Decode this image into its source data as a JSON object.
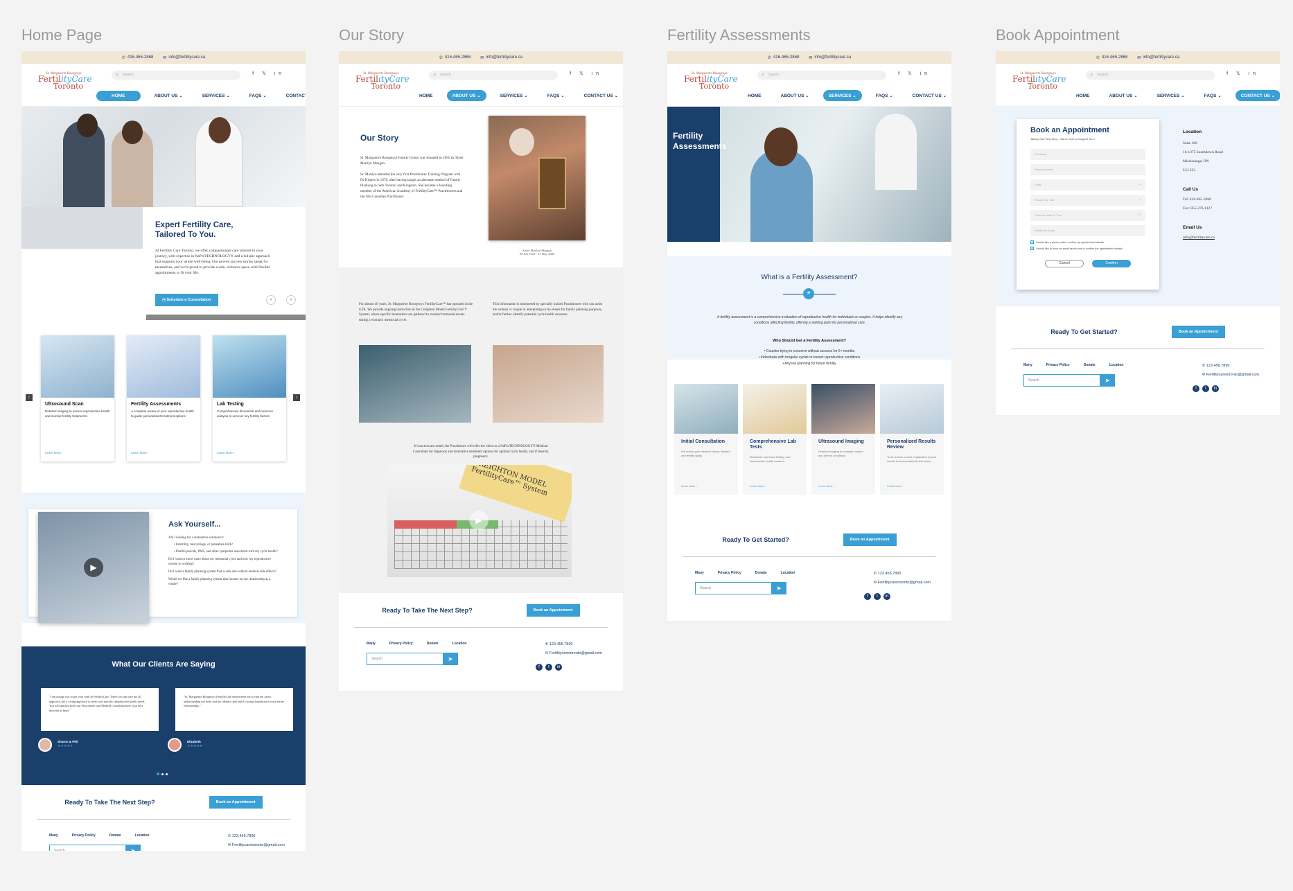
{
  "boards": {
    "home": "Home Page",
    "story": "Our Story",
    "assess": "Fertility Assessments",
    "book": "Book Appointment"
  },
  "topbar": {
    "phone": "416-465-2868",
    "email": "info@fertilitycare.ca"
  },
  "logo": {
    "small": "St. Marguerite Bourgeoys",
    "line1a": "Fertil",
    "line1b": "ityCare",
    "line2": "Toronto"
  },
  "search_placeholder": "Search",
  "social_header": "f  𝕏  in",
  "nav": {
    "home": "HOME",
    "about": "ABOUT US ⌄",
    "services": "SERVICES ⌄",
    "faqs": "FAQS ⌄",
    "contact": "CONTACT US ⌄"
  },
  "home": {
    "hero_title": "Expert Fertility Care, Tailored To You.",
    "hero_text": "At Fertility Care Toronto, we offer compassionate care tailored to your journey, with expertise in NaProTECHNOLOGY® and a holistic approach that supports your whole well-being. Our proven success stories speak for themselves, and we're proud to provide a safe, inclusive space with flexible appointments to fit your life.",
    "hero_btn": "Schedule a Consultation",
    "cards": [
      {
        "title": "Ultrasound Scan",
        "desc": "Detailed imaging to assess reproductive health and monitor fertility treatments.",
        "link": "Learn More ›"
      },
      {
        "title": "Fertility Assessments",
        "desc": "A complete review of your reproductive health to guide personalized treatment options.",
        "link": "Learn More ›"
      },
      {
        "title": "Lab Testing",
        "desc": "Comprehensive bloodwork and hormone analysis to uncover key fertility factors.",
        "link": "Learn More ›"
      }
    ],
    "ask_title": "Ask Yourself...",
    "ask_intro": "Am I looking for a restorative solution to:",
    "ask_b1": "Infertility, miscarriage, or premature birth?",
    "ask_b2": "Painful periods, PMS, and other symptoms associated with my cycle health?",
    "ask_q1": "Do I want to know more about my menstrual cycle and how my reproductive system is working?",
    "ask_q2": "Do I want a family planning system that is safe and without medical side effects?",
    "ask_q3": "Would we like a family planning system that focuses on our relationship as a whole?",
    "testi_title": "What Our Clients Are Saying",
    "testi1": "\"I encourage you to put your faith in FertilityCare. There's no one size fits all approach, but a caring approach to meet your specific reproductive health needs. You will quickly find your Practitioner and Medical Consultant have your best interests at heart.\"",
    "testi2": "\"St. Marguerite Bourgeoys FertilityCare empowered me to find me cause, understanding my body and my identity, and build a strong foundation for my future relationships.\"",
    "name1": "Sharon & Phil",
    "name2": "Elizabeth",
    "stars": "★★★★★"
  },
  "footer": {
    "cta": "Ready To Take The Next Step?",
    "cta2": "Ready To Get Started?",
    "btn": "Book an Appointment",
    "links": [
      "Many",
      "Privacy Policy",
      "Donate",
      "Location"
    ],
    "search": "Search",
    "phone": "123.456.7890",
    "email": "Fertilitycaretoronto@gmail.com"
  },
  "story": {
    "title": "Our Story",
    "p1": "St. Marguerite Bourgeoys Family Centre was founded in 1965 by Sister Marilyn Mangan.",
    "p2": "Sr. Marilyn attended the very first Practitioner Training Program with Dr Hilgers in 1978, after having taught an alternate method of Family Planning in both Toronto and Kingston. She became a founding member of the American Academy of FertilityCare™ Practitioners and the first Canadian Practitioner.",
    "caption1": "Sister Marilyn Mangan",
    "caption2": "05 Feb 1922 - 31 May 2009",
    "p3": "For almost 40 years, St. Marguerite Bourgeoys FertilityCare™ has operated in the GTA. We provide ongoing instruction in the Creighton Model FertilityCare™ System, where specific biomarkers are gathered to monitor hormonal events during a woman's menstrual cycle.",
    "p4": "This information is interpreted by specially trained Practitioners who can assist the woman or couple in interpreting cycle events for family planning purposes, and/or further identify potential cycle health concerns.",
    "p5": "If concerns are noted, the Practitioner will refer the client to a NaProTECHNOLOGY® Medical Consultant for diagnosis and restorative treatment options for optimal cycle health, and if desired, pregnancy.",
    "chart_text": "CREIGHTON MODEL FertilityCare™ System"
  },
  "assess": {
    "hero": "Fertility Assessments",
    "q": "What is a Fertility Assessment?",
    "desc": "A fertility assessment is a comprehensive evaluation of reproductive health for individuals or couples. It helps identify any conditions affecting fertility, offering a starting point for personalized care.",
    "who": "Who Should Get a Fertility Assessment?",
    "w1": "Couples trying to conceive without success for 6+ months",
    "w2": "Individuals with irregular cycles or known reproductive conditions",
    "w3": "Anyone planning for future fertility",
    "cards": [
      {
        "title": "Initial Consultation",
        "desc": "We review your medical history, lifestyle, and fertility goals.",
        "link": "Learn More ›"
      },
      {
        "title": "Comprehensive Lab Tests",
        "desc": "Bloodwork, hormone testing, and reproductive health markers.",
        "link": "Learn More ›"
      },
      {
        "title": "Ultrasound Imaging",
        "desc": "Detailed imaging to evaluate ovarian and uterine conditions.",
        "link": "Learn More ›"
      },
      {
        "title": "Personalized Results Review",
        "desc": "You'll receive a clear explanation of your results and personalized next steps.",
        "link": "Learn More ›"
      }
    ]
  },
  "book": {
    "title": "Book an Appointment",
    "sub": "Taking Your First Step – We're Here to Support You !",
    "f1": "Full Name",
    "f2": "Phone Number",
    "f3": "Email",
    "f4": "Reason for Visit",
    "f5": "Preferred Date & Time",
    "f6": "Additional Notes",
    "c1": "I would like a phone call to confirm my appointment details",
    "c2": "I would like to have an email sent to me to confirm the appointment details",
    "cancel": "Cancel",
    "confirm": "Confirm",
    "loc_h": "Location",
    "loc1": "Suite 106",
    "loc2": "16-1375 Southdown Road",
    "loc3": "Mississauga, ON",
    "loc4": "L5J 2Z1",
    "call_h": "Call Us",
    "tel": "Tel: 416-465-2868",
    "fax": "Fax: 855-276-1127",
    "email_h": "Email Us",
    "email": "info@fertilitycare.ca"
  },
  "colors": {
    "navy": "#1c3d6b",
    "accent": "#3a9fd4",
    "cream": "#f2e6d4",
    "brand_red": "#b5473a"
  }
}
